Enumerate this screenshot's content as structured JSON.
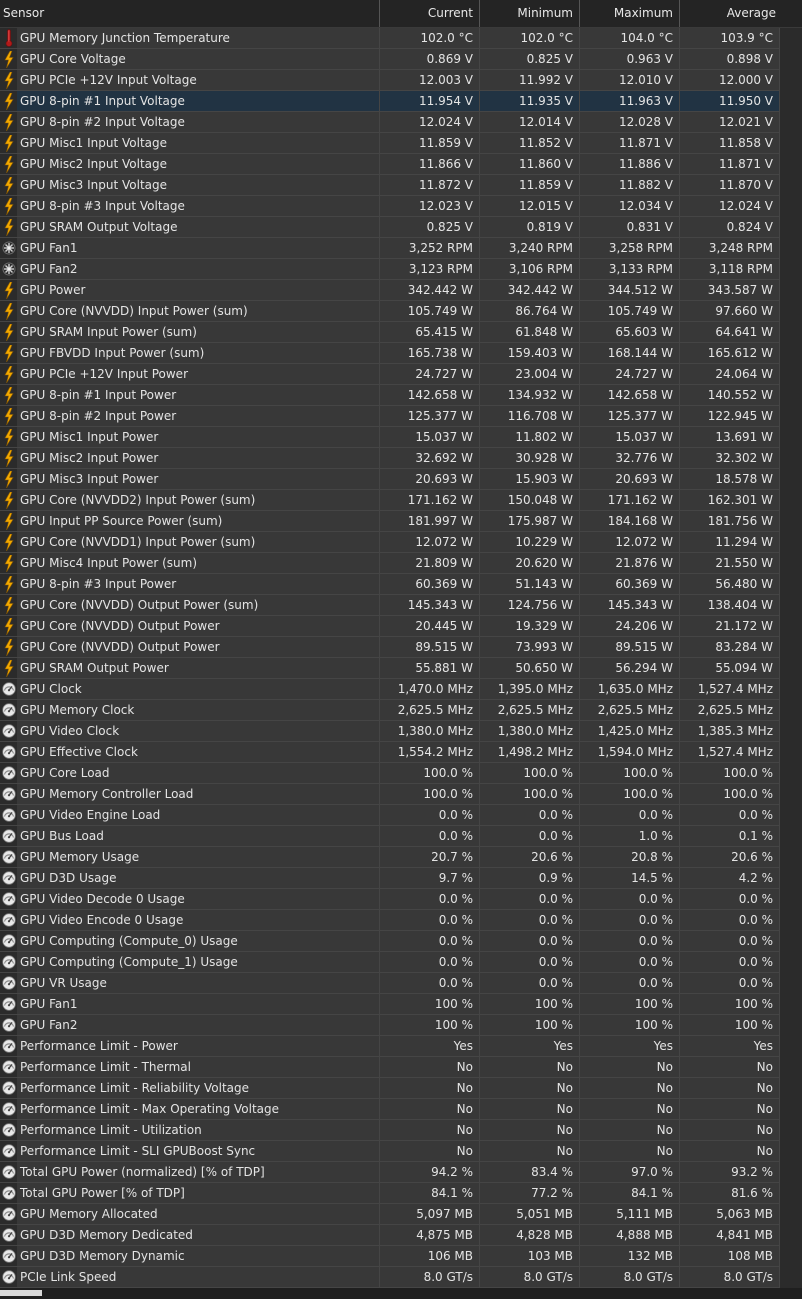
{
  "header": {
    "sensor": "Sensor",
    "current": "Current",
    "minimum": "Minimum",
    "maximum": "Maximum",
    "average": "Average"
  },
  "selected_row": 3,
  "rows": [
    {
      "name": "GPU Memory Junction Temperature",
      "icon": "thermometer-icon",
      "cur": "102.0 °C",
      "min": "102.0 °C",
      "max": "104.0 °C",
      "avg": "103.9 °C"
    },
    {
      "name": "GPU Core Voltage",
      "icon": "lightning-icon",
      "cur": "0.869 V",
      "min": "0.825 V",
      "max": "0.963 V",
      "avg": "0.898 V"
    },
    {
      "name": "GPU PCIe +12V Input Voltage",
      "icon": "lightning-icon",
      "cur": "12.003 V",
      "min": "11.992 V",
      "max": "12.010 V",
      "avg": "12.000 V"
    },
    {
      "name": "GPU 8-pin #1 Input Voltage",
      "icon": "lightning-icon",
      "cur": "11.954 V",
      "min": "11.935 V",
      "max": "11.963 V",
      "avg": "11.950 V"
    },
    {
      "name": "GPU 8-pin #2 Input Voltage",
      "icon": "lightning-icon",
      "cur": "12.024 V",
      "min": "12.014 V",
      "max": "12.028 V",
      "avg": "12.021 V"
    },
    {
      "name": "GPU Misc1 Input Voltage",
      "icon": "lightning-icon",
      "cur": "11.859 V",
      "min": "11.852 V",
      "max": "11.871 V",
      "avg": "11.858 V"
    },
    {
      "name": "GPU Misc2 Input Voltage",
      "icon": "lightning-icon",
      "cur": "11.866 V",
      "min": "11.860 V",
      "max": "11.886 V",
      "avg": "11.871 V"
    },
    {
      "name": "GPU Misc3 Input Voltage",
      "icon": "lightning-icon",
      "cur": "11.872 V",
      "min": "11.859 V",
      "max": "11.882 V",
      "avg": "11.870 V"
    },
    {
      "name": "GPU 8-pin #3 Input Voltage",
      "icon": "lightning-icon",
      "cur": "12.023 V",
      "min": "12.015 V",
      "max": "12.034 V",
      "avg": "12.024 V"
    },
    {
      "name": "GPU SRAM Output Voltage",
      "icon": "lightning-icon",
      "cur": "0.825 V",
      "min": "0.819 V",
      "max": "0.831 V",
      "avg": "0.824 V"
    },
    {
      "name": "GPU Fan1",
      "icon": "fan-icon",
      "cur": "3,252 RPM",
      "min": "3,240 RPM",
      "max": "3,258 RPM",
      "avg": "3,248 RPM"
    },
    {
      "name": "GPU Fan2",
      "icon": "fan-icon",
      "cur": "3,123 RPM",
      "min": "3,106 RPM",
      "max": "3,133 RPM",
      "avg": "3,118 RPM"
    },
    {
      "name": "GPU Power",
      "icon": "lightning-icon",
      "cur": "342.442 W",
      "min": "342.442 W",
      "max": "344.512 W",
      "avg": "343.587 W"
    },
    {
      "name": "GPU Core (NVVDD) Input Power (sum)",
      "icon": "lightning-icon",
      "cur": "105.749 W",
      "min": "86.764 W",
      "max": "105.749 W",
      "avg": "97.660 W"
    },
    {
      "name": "GPU SRAM Input Power (sum)",
      "icon": "lightning-icon",
      "cur": "65.415 W",
      "min": "61.848 W",
      "max": "65.603 W",
      "avg": "64.641 W"
    },
    {
      "name": "GPU FBVDD Input Power (sum)",
      "icon": "lightning-icon",
      "cur": "165.738 W",
      "min": "159.403 W",
      "max": "168.144 W",
      "avg": "165.612 W"
    },
    {
      "name": "GPU PCIe +12V Input Power",
      "icon": "lightning-icon",
      "cur": "24.727 W",
      "min": "23.004 W",
      "max": "24.727 W",
      "avg": "24.064 W"
    },
    {
      "name": "GPU 8-pin #1 Input Power",
      "icon": "lightning-icon",
      "cur": "142.658 W",
      "min": "134.932 W",
      "max": "142.658 W",
      "avg": "140.552 W"
    },
    {
      "name": "GPU 8-pin #2 Input Power",
      "icon": "lightning-icon",
      "cur": "125.377 W",
      "min": "116.708 W",
      "max": "125.377 W",
      "avg": "122.945 W"
    },
    {
      "name": "GPU Misc1 Input Power",
      "icon": "lightning-icon",
      "cur": "15.037 W",
      "min": "11.802 W",
      "max": "15.037 W",
      "avg": "13.691 W"
    },
    {
      "name": "GPU Misc2 Input Power",
      "icon": "lightning-icon",
      "cur": "32.692 W",
      "min": "30.928 W",
      "max": "32.776 W",
      "avg": "32.302 W"
    },
    {
      "name": "GPU Misc3 Input Power",
      "icon": "lightning-icon",
      "cur": "20.693 W",
      "min": "15.903 W",
      "max": "20.693 W",
      "avg": "18.578 W"
    },
    {
      "name": "GPU Core (NVVDD2) Input Power (sum)",
      "icon": "lightning-icon",
      "cur": "171.162 W",
      "min": "150.048 W",
      "max": "171.162 W",
      "avg": "162.301 W"
    },
    {
      "name": "GPU Input PP Source Power (sum)",
      "icon": "lightning-icon",
      "cur": "181.997 W",
      "min": "175.987 W",
      "max": "184.168 W",
      "avg": "181.756 W"
    },
    {
      "name": "GPU Core (NVVDD1) Input Power (sum)",
      "icon": "lightning-icon",
      "cur": "12.072 W",
      "min": "10.229 W",
      "max": "12.072 W",
      "avg": "11.294 W"
    },
    {
      "name": "GPU Misc4 Input Power (sum)",
      "icon": "lightning-icon",
      "cur": "21.809 W",
      "min": "20.620 W",
      "max": "21.876 W",
      "avg": "21.550 W"
    },
    {
      "name": "GPU 8-pin #3 Input Power",
      "icon": "lightning-icon",
      "cur": "60.369 W",
      "min": "51.143 W",
      "max": "60.369 W",
      "avg": "56.480 W"
    },
    {
      "name": "GPU Core (NVVDD) Output Power (sum)",
      "icon": "lightning-icon",
      "cur": "145.343 W",
      "min": "124.756 W",
      "max": "145.343 W",
      "avg": "138.404 W"
    },
    {
      "name": "GPU Core (NVVDD) Output Power",
      "icon": "lightning-icon",
      "cur": "20.445 W",
      "min": "19.329 W",
      "max": "24.206 W",
      "avg": "21.172 W"
    },
    {
      "name": "GPU Core (NVVDD) Output Power",
      "icon": "lightning-icon",
      "cur": "89.515 W",
      "min": "73.993 W",
      "max": "89.515 W",
      "avg": "83.284 W"
    },
    {
      "name": "GPU SRAM Output Power",
      "icon": "lightning-icon",
      "cur": "55.881 W",
      "min": "50.650 W",
      "max": "56.294 W",
      "avg": "55.094 W"
    },
    {
      "name": "GPU Clock",
      "icon": "gauge-icon",
      "cur": "1,470.0 MHz",
      "min": "1,395.0 MHz",
      "max": "1,635.0 MHz",
      "avg": "1,527.4 MHz"
    },
    {
      "name": "GPU Memory Clock",
      "icon": "gauge-icon",
      "cur": "2,625.5 MHz",
      "min": "2,625.5 MHz",
      "max": "2,625.5 MHz",
      "avg": "2,625.5 MHz"
    },
    {
      "name": "GPU Video Clock",
      "icon": "gauge-icon",
      "cur": "1,380.0 MHz",
      "min": "1,380.0 MHz",
      "max": "1,425.0 MHz",
      "avg": "1,385.3 MHz"
    },
    {
      "name": "GPU Effective Clock",
      "icon": "gauge-icon",
      "cur": "1,554.2 MHz",
      "min": "1,498.2 MHz",
      "max": "1,594.0 MHz",
      "avg": "1,527.4 MHz"
    },
    {
      "name": "GPU Core Load",
      "icon": "gauge-icon",
      "cur": "100.0 %",
      "min": "100.0 %",
      "max": "100.0 %",
      "avg": "100.0 %"
    },
    {
      "name": "GPU Memory Controller Load",
      "icon": "gauge-icon",
      "cur": "100.0 %",
      "min": "100.0 %",
      "max": "100.0 %",
      "avg": "100.0 %"
    },
    {
      "name": "GPU Video Engine Load",
      "icon": "gauge-icon",
      "cur": "0.0 %",
      "min": "0.0 %",
      "max": "0.0 %",
      "avg": "0.0 %"
    },
    {
      "name": "GPU Bus Load",
      "icon": "gauge-icon",
      "cur": "0.0 %",
      "min": "0.0 %",
      "max": "1.0 %",
      "avg": "0.1 %"
    },
    {
      "name": "GPU Memory Usage",
      "icon": "gauge-icon",
      "cur": "20.7 %",
      "min": "20.6 %",
      "max": "20.8 %",
      "avg": "20.6 %"
    },
    {
      "name": "GPU D3D Usage",
      "icon": "gauge-icon",
      "cur": "9.7 %",
      "min": "0.9 %",
      "max": "14.5 %",
      "avg": "4.2 %"
    },
    {
      "name": "GPU Video Decode 0 Usage",
      "icon": "gauge-icon",
      "cur": "0.0 %",
      "min": "0.0 %",
      "max": "0.0 %",
      "avg": "0.0 %"
    },
    {
      "name": "GPU Video Encode 0 Usage",
      "icon": "gauge-icon",
      "cur": "0.0 %",
      "min": "0.0 %",
      "max": "0.0 %",
      "avg": "0.0 %"
    },
    {
      "name": "GPU Computing (Compute_0) Usage",
      "icon": "gauge-icon",
      "cur": "0.0 %",
      "min": "0.0 %",
      "max": "0.0 %",
      "avg": "0.0 %"
    },
    {
      "name": "GPU Computing (Compute_1) Usage",
      "icon": "gauge-icon",
      "cur": "0.0 %",
      "min": "0.0 %",
      "max": "0.0 %",
      "avg": "0.0 %"
    },
    {
      "name": "GPU VR Usage",
      "icon": "gauge-icon",
      "cur": "0.0 %",
      "min": "0.0 %",
      "max": "0.0 %",
      "avg": "0.0 %"
    },
    {
      "name": "GPU Fan1",
      "icon": "gauge-icon",
      "cur": "100 %",
      "min": "100 %",
      "max": "100 %",
      "avg": "100 %"
    },
    {
      "name": "GPU Fan2",
      "icon": "gauge-icon",
      "cur": "100 %",
      "min": "100 %",
      "max": "100 %",
      "avg": "100 %"
    },
    {
      "name": "Performance Limit - Power",
      "icon": "gauge-icon",
      "cur": "Yes",
      "min": "Yes",
      "max": "Yes",
      "avg": "Yes"
    },
    {
      "name": "Performance Limit - Thermal",
      "icon": "gauge-icon",
      "cur": "No",
      "min": "No",
      "max": "No",
      "avg": "No"
    },
    {
      "name": "Performance Limit - Reliability Voltage",
      "icon": "gauge-icon",
      "cur": "No",
      "min": "No",
      "max": "No",
      "avg": "No"
    },
    {
      "name": "Performance Limit - Max Operating Voltage",
      "icon": "gauge-icon",
      "cur": "No",
      "min": "No",
      "max": "No",
      "avg": "No"
    },
    {
      "name": "Performance Limit - Utilization",
      "icon": "gauge-icon",
      "cur": "No",
      "min": "No",
      "max": "No",
      "avg": "No"
    },
    {
      "name": "Performance Limit - SLI GPUBoost Sync",
      "icon": "gauge-icon",
      "cur": "No",
      "min": "No",
      "max": "No",
      "avg": "No"
    },
    {
      "name": "Total GPU Power (normalized) [% of TDP]",
      "icon": "gauge-icon",
      "cur": "94.2 %",
      "min": "83.4 %",
      "max": "97.0 %",
      "avg": "93.2 %"
    },
    {
      "name": "Total GPU Power [% of TDP]",
      "icon": "gauge-icon",
      "cur": "84.1 %",
      "min": "77.2 %",
      "max": "84.1 %",
      "avg": "81.6 %"
    },
    {
      "name": "GPU Memory Allocated",
      "icon": "gauge-icon",
      "cur": "5,097 MB",
      "min": "5,051 MB",
      "max": "5,111 MB",
      "avg": "5,063 MB"
    },
    {
      "name": "GPU D3D Memory Dedicated",
      "icon": "gauge-icon",
      "cur": "4,875 MB",
      "min": "4,828 MB",
      "max": "4,888 MB",
      "avg": "4,841 MB"
    },
    {
      "name": "GPU D3D Memory Dynamic",
      "icon": "gauge-icon",
      "cur": "106 MB",
      "min": "103 MB",
      "max": "132 MB",
      "avg": "108 MB"
    },
    {
      "name": "PCIe Link Speed",
      "icon": "gauge-icon",
      "cur": "8.0 GT/s",
      "min": "8.0 GT/s",
      "max": "8.0 GT/s",
      "avg": "8.0 GT/s"
    }
  ]
}
